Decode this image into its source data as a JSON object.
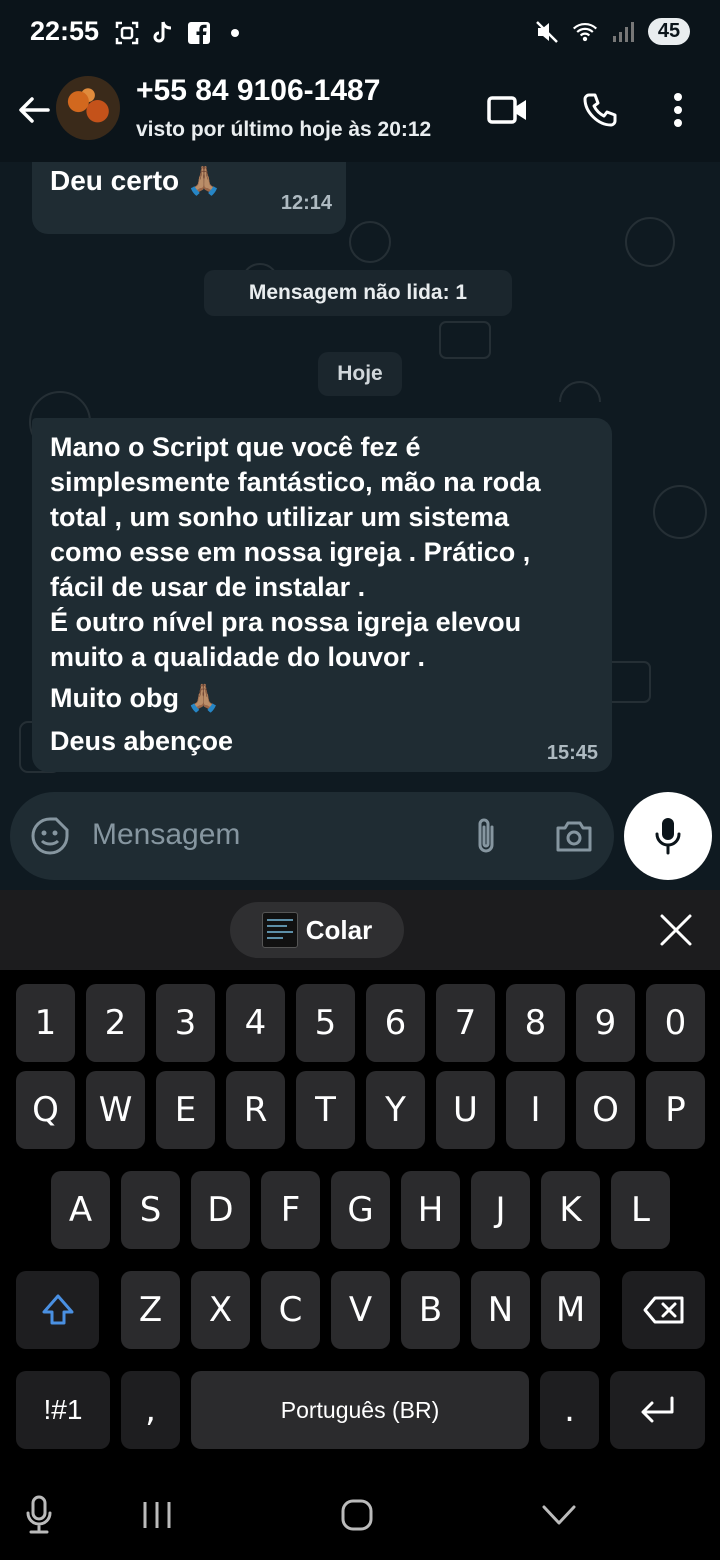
{
  "status_bar": {
    "time": "22:55",
    "battery": "45",
    "left_icons": [
      "screenshot-icon",
      "tiktok-icon",
      "facebook-icon",
      "dot-icon"
    ],
    "right_icons": [
      "mute-icon",
      "wifi-icon",
      "signal-icon"
    ]
  },
  "header": {
    "contact_name": "+55 84 9106-1487",
    "last_seen": "visto por último hoje às 20:12",
    "icons": [
      "back-arrow-icon",
      "video-call-icon",
      "phone-icon",
      "more-options-icon"
    ]
  },
  "chat": {
    "previous_message": {
      "text": "Deu certo 🙏🏽",
      "time": "12:14"
    },
    "unread_banner": "Mensagem não lida: 1",
    "day_separator": "Hoje",
    "message": {
      "lines": [
        "Mano o Script que você fez é",
        "simplesmente fantástico, mão na roda",
        "total , um sonho utilizar um sistema",
        "como esse em nossa igreja . Prático ,",
        "fácil de usar de instalar .",
        "É outro nível pra nossa igreja elevou",
        "muito a qualidade do louvor .",
        "Muito obg 🙏🏽",
        "Deus abençoe"
      ],
      "time": "15:45"
    }
  },
  "composer": {
    "placeholder": "Mensagem",
    "icons": [
      "sticker-icon",
      "attach-icon",
      "camera-icon",
      "mic-icon"
    ]
  },
  "keyboard": {
    "clipboard_chip": "Colar",
    "number_row": [
      "1",
      "2",
      "3",
      "4",
      "5",
      "6",
      "7",
      "8",
      "9",
      "0"
    ],
    "row1": [
      "Q",
      "W",
      "E",
      "R",
      "T",
      "Y",
      "U",
      "I",
      "O",
      "P"
    ],
    "row2": [
      "A",
      "S",
      "D",
      "F",
      "G",
      "H",
      "J",
      "K",
      "L"
    ],
    "row3": [
      "Z",
      "X",
      "C",
      "V",
      "B",
      "N",
      "M"
    ],
    "symbols_key": "!#1",
    "comma_key": ",",
    "space_label": "Português (BR)",
    "period_key": ".",
    "accent_color": "#4a90e2"
  },
  "nav_bar": {
    "icons": [
      "voice-input-icon",
      "recents-icon",
      "home-icon",
      "back-down-icon"
    ]
  }
}
